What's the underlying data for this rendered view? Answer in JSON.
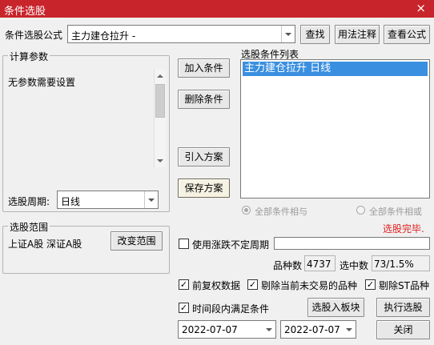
{
  "window": {
    "title": "条件选股",
    "close": "×"
  },
  "formula": {
    "label": "条件选股公式",
    "value": "主力建仓拉升 -",
    "find_button": "查找",
    "usage_button": "用法注释",
    "view_button": "查看公式"
  },
  "params": {
    "legend": "计算参数",
    "text": "无参数需要设置",
    "period_label": "选股周期:",
    "period_value": "日线"
  },
  "actions": {
    "add": "加入条件",
    "delete": "删除条件",
    "import": "引入方案",
    "save": "保存方案"
  },
  "conditions": {
    "label": "选股条件列表",
    "items": [
      "主力建仓拉升  日线"
    ],
    "and_label": "全部条件相与",
    "or_label": "全部条件相或",
    "status": "选股完毕."
  },
  "scope": {
    "legend": "选股范围",
    "value": "上证A股 深证A股",
    "change_button": "改变范围"
  },
  "options": {
    "variable_period_label": "使用涨跌不定周期",
    "count_label": "品种数",
    "count_value": "4737",
    "selected_label": "选中数",
    "selected_value": "73/1.5%",
    "adjust_label": "前复权数据",
    "exclude_untraded_label": "剔除当前未交易的品种",
    "exclude_st_label": "剔除ST品种",
    "time_range_label": "时间段内满足条件",
    "check_mark": "✓"
  },
  "buttons": {
    "to_block": "选股入板块",
    "run": "执行选股",
    "close": "关闭"
  },
  "dates": {
    "start": "2022-07-07",
    "end": "2022-07-07"
  }
}
